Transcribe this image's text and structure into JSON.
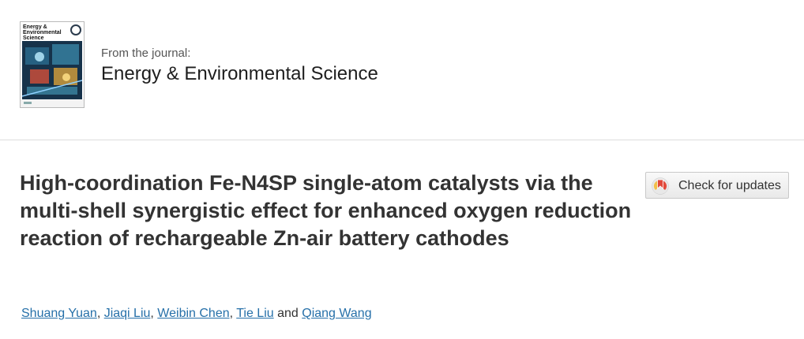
{
  "journal": {
    "cover_title": "Energy & Environmental Science",
    "from_label": "From the journal:",
    "name": "Energy & Environmental Science"
  },
  "article": {
    "title": "High-coordination Fe-N4SP single-atom catalysts via the multi-shell synergistic effect for enhanced oxygen reduction reaction of rechargeable Zn-air battery cathodes"
  },
  "check_updates": {
    "label": "Check for updates"
  },
  "authors": [
    {
      "name": "Shuang Yuan",
      "after": ", "
    },
    {
      "name": "Jiaqi Liu",
      "after": ", "
    },
    {
      "name": "Weibin Chen",
      "after": ", "
    },
    {
      "name": "Tie Liu",
      "after": " and "
    },
    {
      "name": "Qiang Wang",
      "after": ""
    }
  ],
  "colors": {
    "link": "#2670a9",
    "title": "#333333",
    "divider": "#dddddd"
  }
}
